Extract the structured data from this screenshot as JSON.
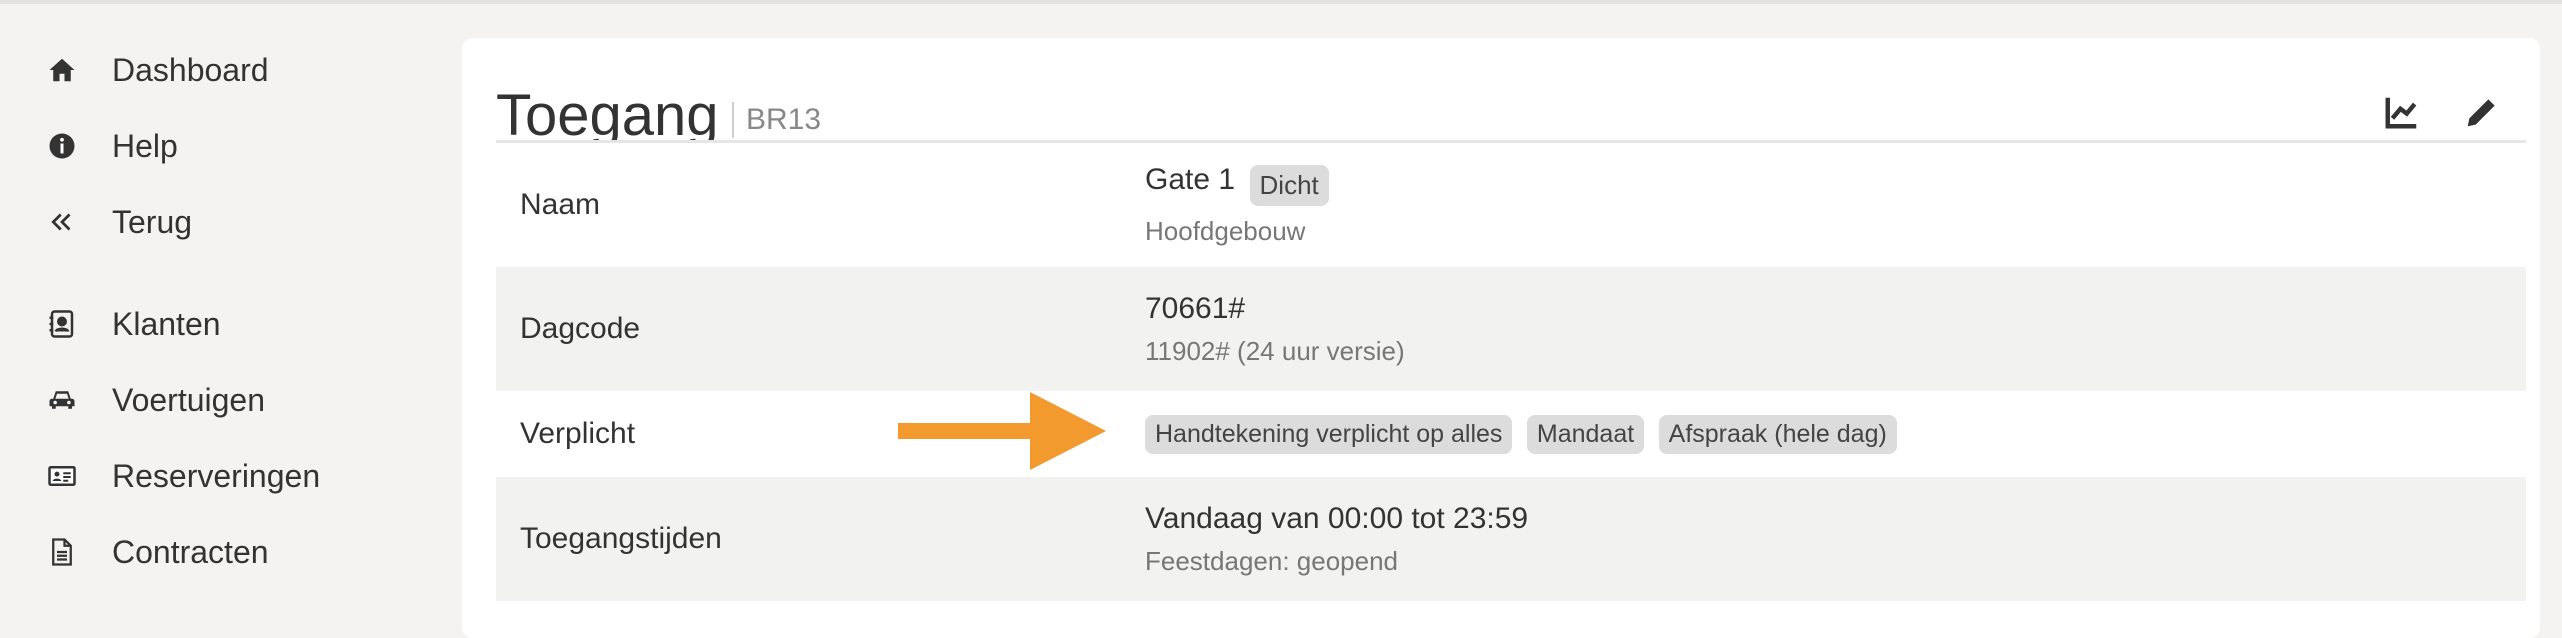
{
  "sidebar": {
    "items": [
      {
        "label": "Dashboard",
        "icon": "home-icon"
      },
      {
        "label": "Help",
        "icon": "info-icon"
      },
      {
        "label": "Terug",
        "icon": "double-chevron-left-icon"
      },
      {
        "label": "Klanten",
        "icon": "contact-book-icon"
      },
      {
        "label": "Voertuigen",
        "icon": "car-icon"
      },
      {
        "label": "Reserveringen",
        "icon": "id-card-icon"
      },
      {
        "label": "Contracten",
        "icon": "document-icon"
      }
    ]
  },
  "header": {
    "title": "Toegang",
    "subtitle": "BR13",
    "actions": [
      {
        "name": "chart-icon"
      },
      {
        "name": "pencil-icon"
      }
    ]
  },
  "details": {
    "rows": [
      {
        "key": "Naam",
        "value": "Gate 1",
        "badge": "Dicht",
        "sub": "Hoofdgebouw"
      },
      {
        "key": "Dagcode",
        "value": "70661#",
        "sub": "11902# (24 uur versie)"
      },
      {
        "key": "Verplicht",
        "badges": [
          "Handtekening verplicht op alles",
          "Mandaat",
          "Afspraak (hele dag)"
        ]
      },
      {
        "key": "Toegangstijden",
        "value": "Vandaag van 00:00 tot 23:59",
        "sub": "Feestdagen: geopend"
      }
    ]
  },
  "colors": {
    "arrow": "#f29a2e",
    "badge_bg": "#dcdcdc",
    "striped_row": "#f2f2f0"
  }
}
